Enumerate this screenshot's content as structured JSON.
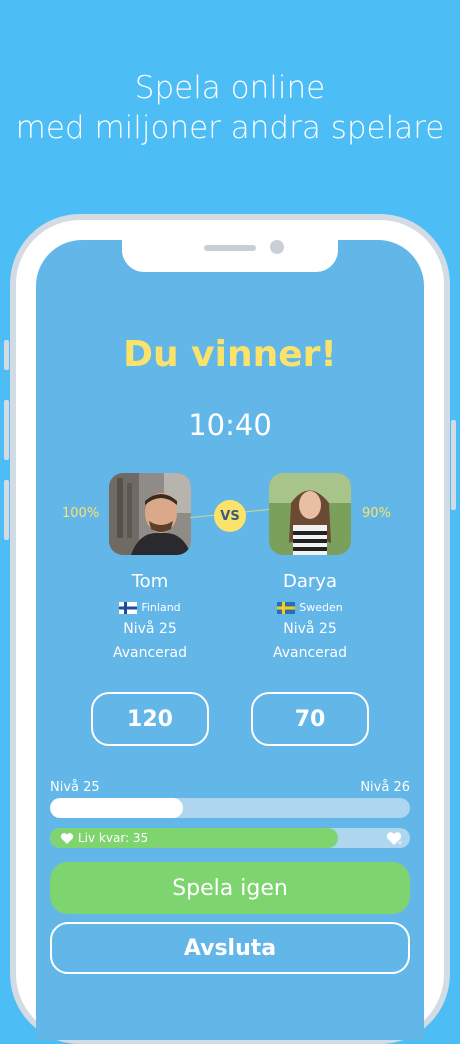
{
  "headline": {
    "line1": "Spela online",
    "line2": "med miljoner andra spelare"
  },
  "game": {
    "result_title": "Du vinner!",
    "timer": "10:40",
    "vs_label": "VS"
  },
  "player_left": {
    "name": "Tom",
    "country": "Finland",
    "level": "Nivå 25",
    "rank": "Avancerad",
    "percent": "100%",
    "score": "120"
  },
  "player_right": {
    "name": "Darya",
    "country": "Sweden",
    "level": "Nivå 25",
    "rank": "Avancerad",
    "percent": "90%",
    "score": "70"
  },
  "progress": {
    "level_current": "Nivå 25",
    "level_next": "Nivå 26",
    "level_fraction": 0.37,
    "lives_label": "Liv kvar: 35",
    "lives_fraction": 0.8
  },
  "buttons": {
    "play_again": "Spela igen",
    "quit": "Avsluta"
  },
  "colors": {
    "background": "#4dbdf5",
    "screen": "#62b7e8",
    "accent_yellow": "#fbe36b",
    "accent_green": "#7ed56f"
  }
}
